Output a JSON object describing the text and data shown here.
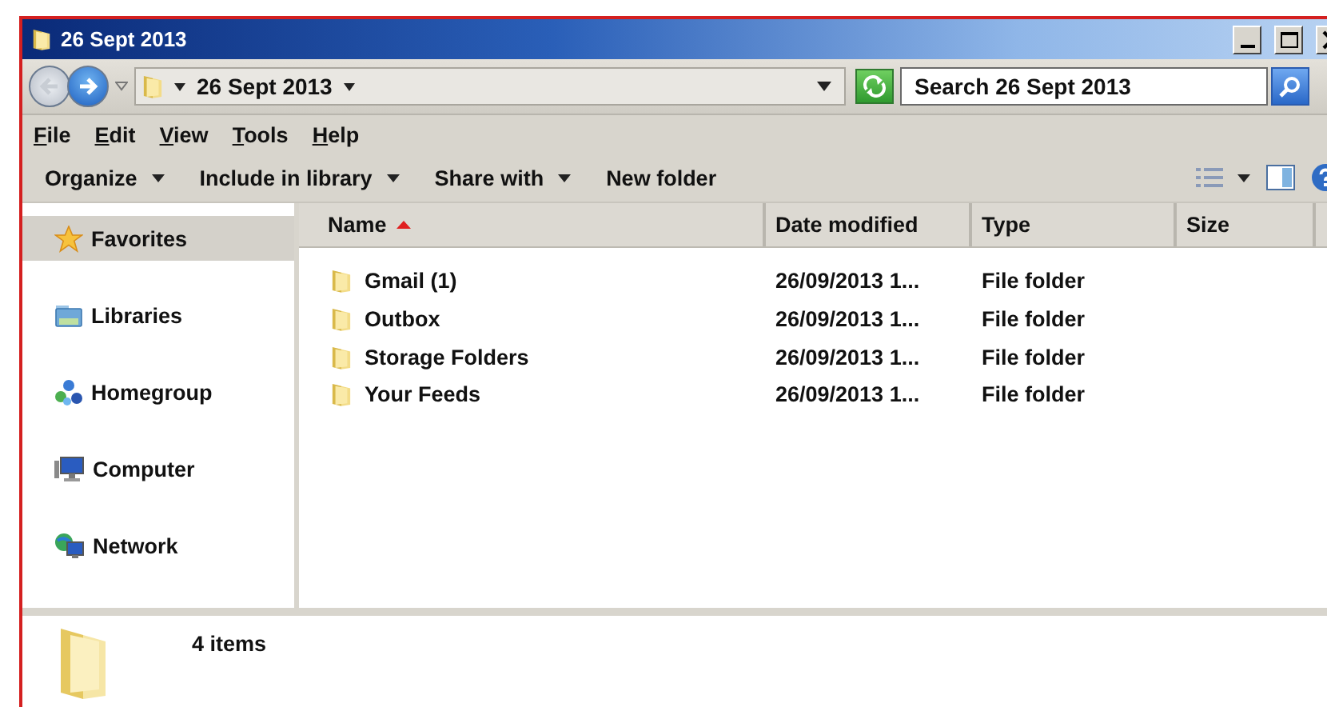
{
  "window": {
    "title": "26 Sept 2013"
  },
  "address_bar": {
    "path": "26 Sept 2013"
  },
  "search": {
    "placeholder": "Search 26 Sept 2013"
  },
  "menu": [
    "File",
    "Edit",
    "View",
    "Tools",
    "Help"
  ],
  "toolbar": [
    {
      "label": "Organize",
      "dropdown": true
    },
    {
      "label": "Include in library",
      "dropdown": true
    },
    {
      "label": "Share with",
      "dropdown": true
    },
    {
      "label": "New folder",
      "dropdown": false
    }
  ],
  "sidebar": {
    "items": [
      {
        "label": "Favorites",
        "kind": "favorites",
        "selected": true
      },
      {
        "label": "Libraries",
        "kind": "libraries",
        "selected": false
      },
      {
        "label": "Homegroup",
        "kind": "homegroup",
        "selected": false
      },
      {
        "label": "Computer",
        "kind": "computer",
        "selected": false
      },
      {
        "label": "Network",
        "kind": "network",
        "selected": false
      }
    ]
  },
  "table": {
    "columns": [
      {
        "label": "Name",
        "sorted": true
      },
      {
        "label": "Date modified",
        "sorted": false
      },
      {
        "label": "Type",
        "sorted": false
      },
      {
        "label": "Size",
        "sorted": false
      }
    ],
    "rows": [
      {
        "name": "Gmail (1)",
        "date": "26/09/2013 1...",
        "type": "File folder"
      },
      {
        "name": "Outbox",
        "date": "26/09/2013 1...",
        "type": "File folder"
      },
      {
        "name": "Storage Folders",
        "date": "26/09/2013 1...",
        "type": "File folder"
      },
      {
        "name": "Your Feeds",
        "date": "26/09/2013 1...",
        "type": "File folder"
      }
    ]
  },
  "status_bar": {
    "count": "4 items"
  }
}
